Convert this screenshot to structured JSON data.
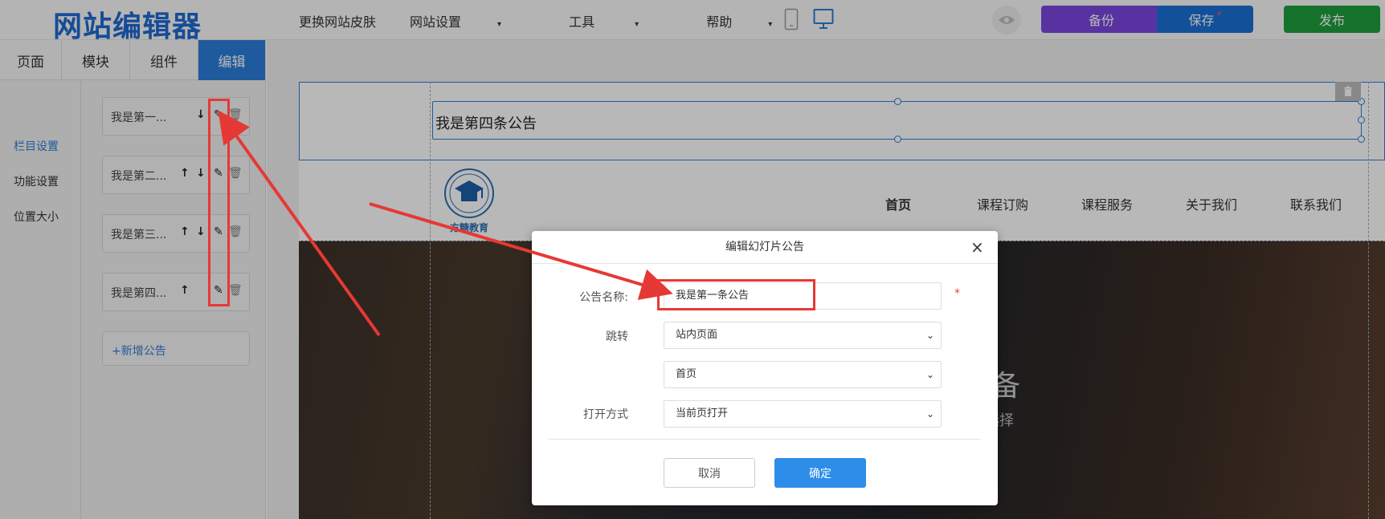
{
  "app": {
    "logo": "网站编辑器"
  },
  "topnav": {
    "items": [
      "更换网站皮肤",
      "网站设置",
      "工具",
      "帮助"
    ]
  },
  "actions": {
    "backup": "备份",
    "save": "保存",
    "save_dot": "*",
    "publish": "发布"
  },
  "left_tabs": [
    {
      "label": "页面",
      "active": false
    },
    {
      "label": "模块",
      "active": false
    },
    {
      "label": "组件",
      "active": false
    },
    {
      "label": "编辑",
      "active": true
    }
  ],
  "side_nav": [
    "栏目设置",
    "功能设置",
    "位置大小"
  ],
  "notice_items": [
    "我是第一...",
    "我是第二...",
    "我是第三...",
    "我是第四..."
  ],
  "add_notice": "+新增公告",
  "canvas": {
    "notice_text": "我是第四条公告",
    "logo_caption": "方糖教育",
    "site_nav": [
      "首页",
      "课程订购",
      "课程服务",
      "关于我们",
      "联系我们"
    ],
    "hero_title": "准备",
    "hero_subtitle": "选择"
  },
  "modal": {
    "title": "编辑幻灯片公告",
    "close": "×",
    "name_label": "公告名称:",
    "name_value": "我是第一条公告",
    "required_mark": "*",
    "jump_label": "跳转",
    "jump_type": "站内页面",
    "jump_page": "首页",
    "open_label": "打开方式",
    "open_value": "当前页打开",
    "cancel": "取消",
    "ok": "确定"
  },
  "colors": {
    "brand": "#1e6ad1",
    "backup": "#7b46e0",
    "save": "#1a6fd6",
    "publish": "#1e9f3c",
    "tab_active": "#2b7ddc",
    "annotation": "#e53935"
  }
}
